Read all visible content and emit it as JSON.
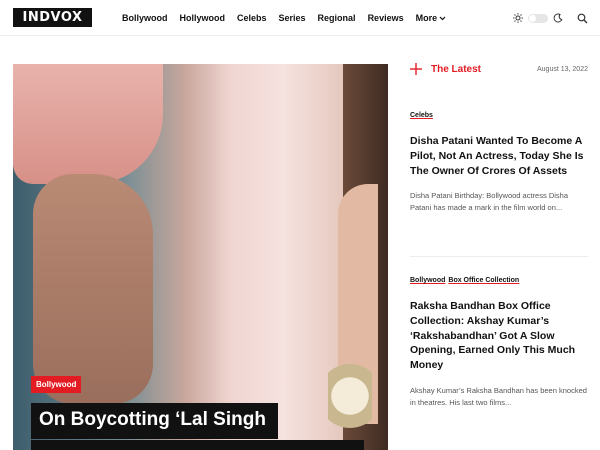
{
  "brand": {
    "logo_text": "INDVOX"
  },
  "nav": {
    "items": [
      "Bollywood",
      "Hollywood",
      "Celebs",
      "Series",
      "Regional",
      "Reviews"
    ],
    "more_label": "More"
  },
  "hero": {
    "category": "Bollywood",
    "title": "On Boycotting ‘Lal Singh"
  },
  "sidebar": {
    "heading": "The Latest",
    "date": "August 13, 2022",
    "posts": [
      {
        "categories": [
          "Celebs"
        ],
        "title": "Disha Patani Wanted To Become A Pilot, Not An Actress, Today She Is The Owner Of Crores Of Assets",
        "excerpt": "Disha Patani Birthday: Bollywood actress Disha Patani has made a mark in the film world on..."
      },
      {
        "categories": [
          "Bollywood",
          "Box Office Collection"
        ],
        "title": "Raksha Bandhan Box Office Collection: Akshay Kumar’s ‘Rakshabandhan’ Got A Slow Opening, Earned Only This Much Money",
        "excerpt": "Akshay Kumar’s Raksha Bandhan has been knocked in theatres. His last two films..."
      }
    ]
  },
  "colors": {
    "accent": "#e31b23",
    "text": "#111111"
  }
}
